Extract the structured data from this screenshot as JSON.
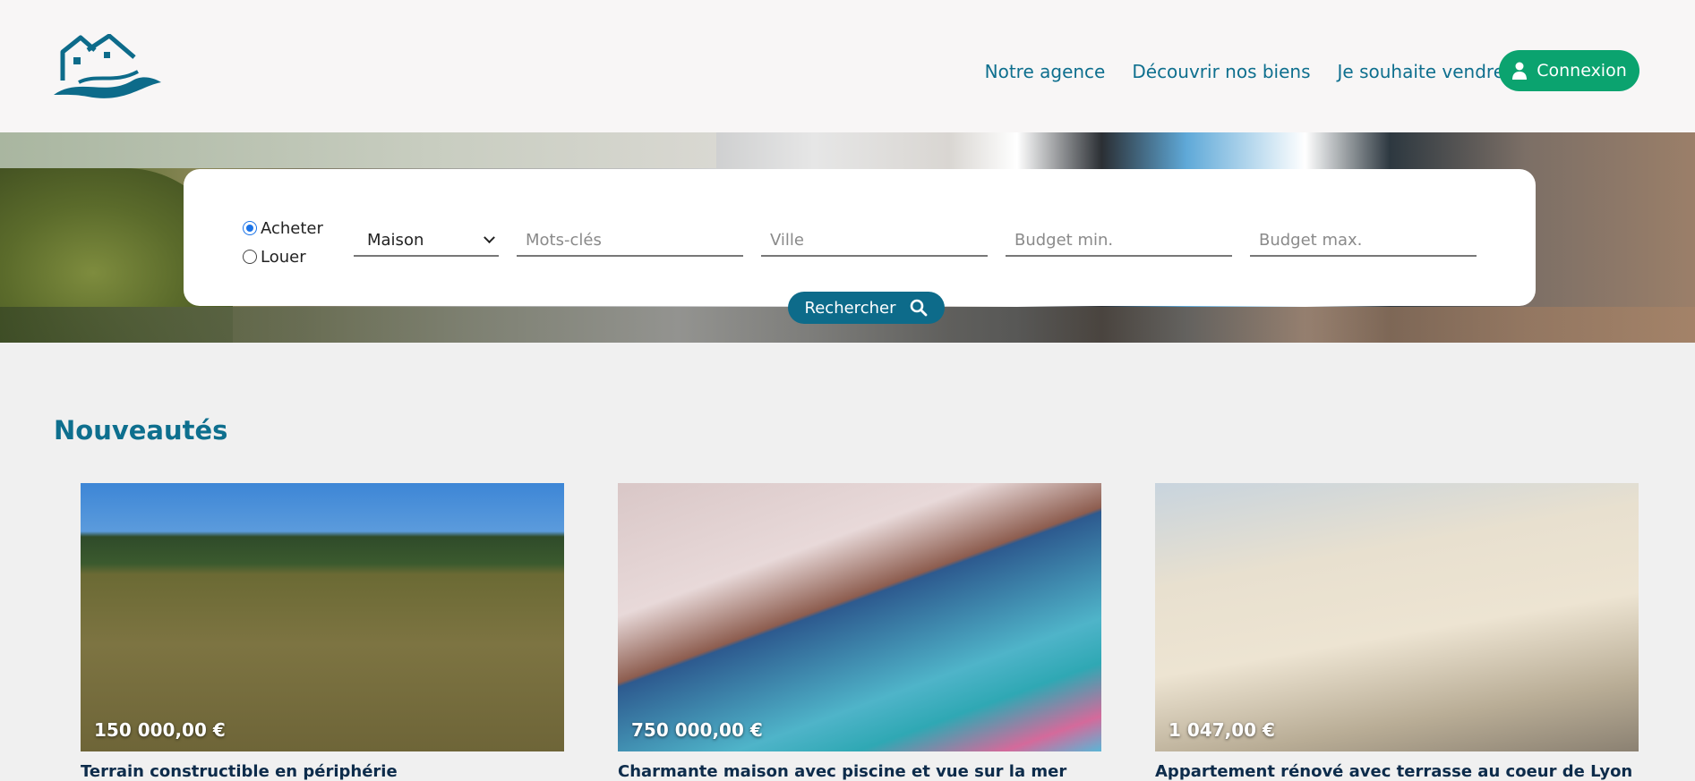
{
  "nav": {
    "links": [
      "Notre agence",
      "Découvrir nos biens",
      "Je souhaite vendre"
    ],
    "login_label": "Connexion"
  },
  "search": {
    "radio_buy": "Acheter",
    "radio_rent": "Louer",
    "selected_mode": "Acheter",
    "type_value": "Maison",
    "keywords_placeholder": "Mots-clés",
    "city_placeholder": "Ville",
    "budget_min_placeholder": "Budget min.",
    "budget_max_placeholder": "Budget max.",
    "submit_label": "Rechercher"
  },
  "news": {
    "title": "Nouveautés",
    "cards": [
      {
        "price": "150 000,00 €",
        "title": "Terrain constructible en périphérie"
      },
      {
        "price": "750 000,00 €",
        "title": "Charmante maison avec piscine et vue sur la mer"
      },
      {
        "price": "1 047,00 €",
        "title": "Appartement rénové avec terrasse au coeur de Lyon"
      }
    ]
  },
  "colors": {
    "primary": "#0e6f8e",
    "login_button": "#0ba36f",
    "search_button": "#0d6b8a"
  }
}
